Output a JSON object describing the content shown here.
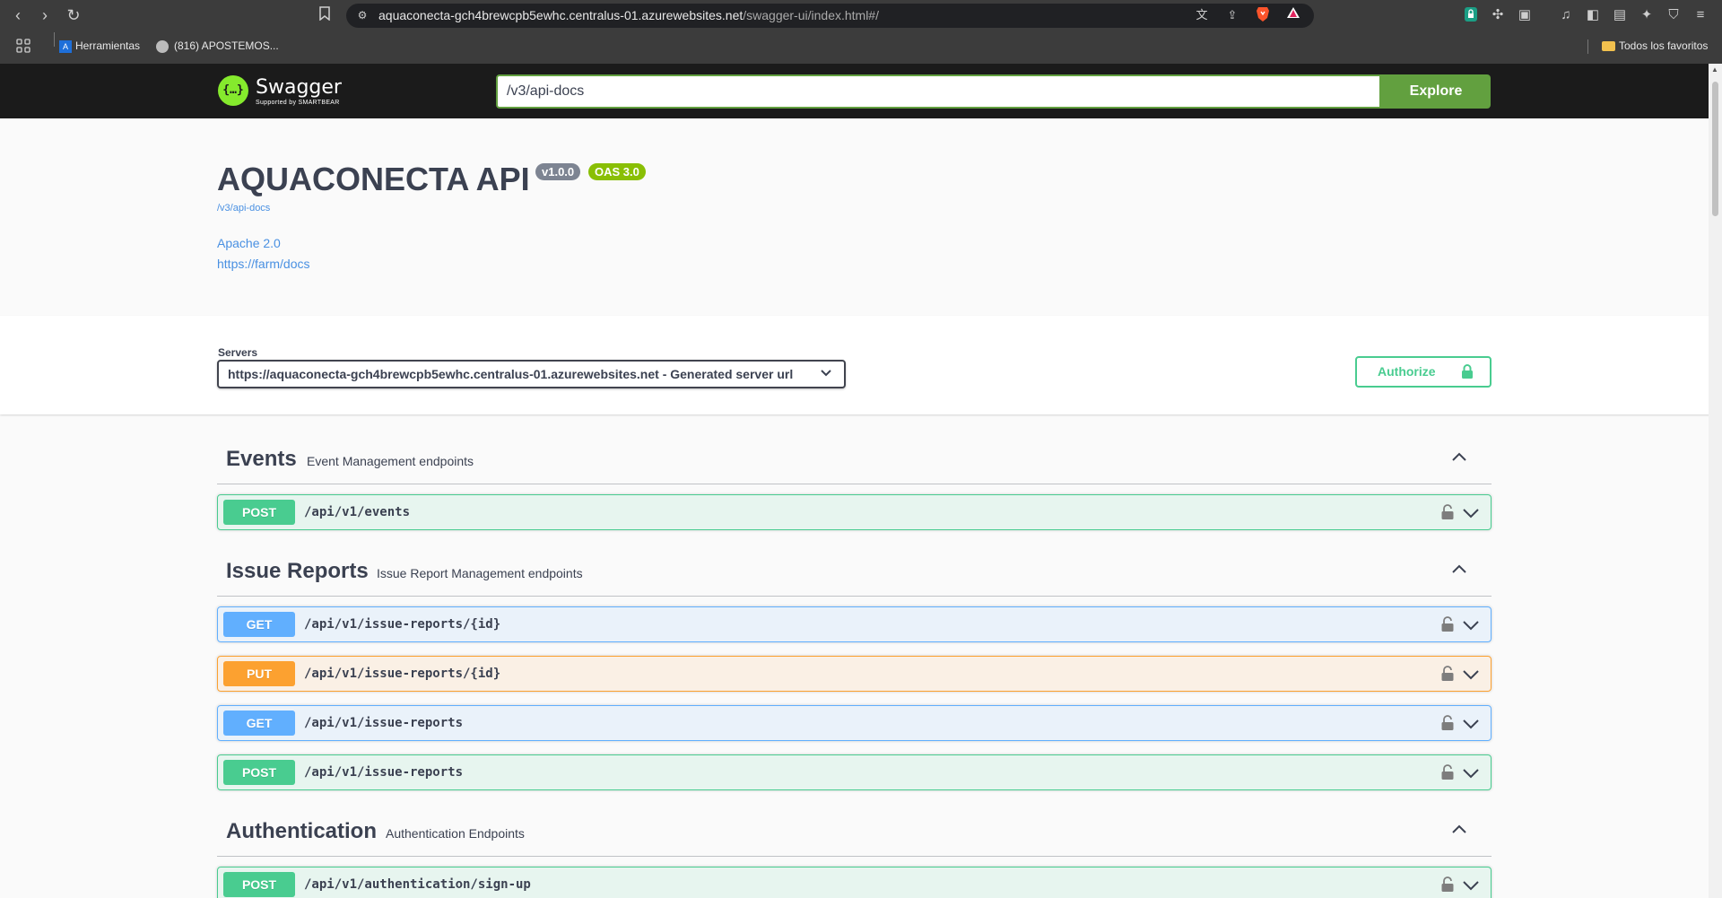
{
  "browser": {
    "url_host": "aquaconecta-gch4brewcpb5ewhc.centralus-01.azurewebsites.net",
    "url_path": "/swagger-ui/index.html#/",
    "bookmarks": [
      {
        "label": "Herramientas"
      },
      {
        "label": "(816) APOSTEMOS..."
      }
    ],
    "all_bookmarks_label": "Todos los favoritos"
  },
  "swagger": {
    "logo_text": "Swagger",
    "logo_sub": "Supported by SMARTBEAR",
    "logo_glyph": "{…}",
    "explore_value": "/v3/api-docs",
    "explore_label": "Explore"
  },
  "info": {
    "title": "AQUACONECTA API",
    "version": "v1.0.0",
    "oas": "OAS 3.0",
    "spec_link": "/v3/api-docs",
    "license": "Apache 2.0",
    "docs_link": "https://farm/docs"
  },
  "servers": {
    "label": "Servers",
    "selected": "https://aquaconecta-gch4brewcpb5ewhc.centralus-01.azurewebsites.net - Generated server url",
    "authorize_label": "Authorize"
  },
  "tags": [
    {
      "name": "Events",
      "description": "Event Management endpoints",
      "operations": [
        {
          "method": "POST",
          "path": "/api/v1/events"
        }
      ]
    },
    {
      "name": "Issue Reports",
      "description": "Issue Report Management endpoints",
      "operations": [
        {
          "method": "GET",
          "path": "/api/v1/issue-reports/{id}"
        },
        {
          "method": "PUT",
          "path": "/api/v1/issue-reports/{id}"
        },
        {
          "method": "GET",
          "path": "/api/v1/issue-reports"
        },
        {
          "method": "POST",
          "path": "/api/v1/issue-reports"
        }
      ]
    },
    {
      "name": "Authentication",
      "description": "Authentication Endpoints",
      "operations": [
        {
          "method": "POST",
          "path": "/api/v1/authentication/sign-up"
        }
      ]
    }
  ],
  "colors": {
    "post": "#49cc90",
    "get": "#61affe",
    "put": "#fca130",
    "swagger_green": "#62a03f",
    "topbar": "#1b1b1b"
  }
}
